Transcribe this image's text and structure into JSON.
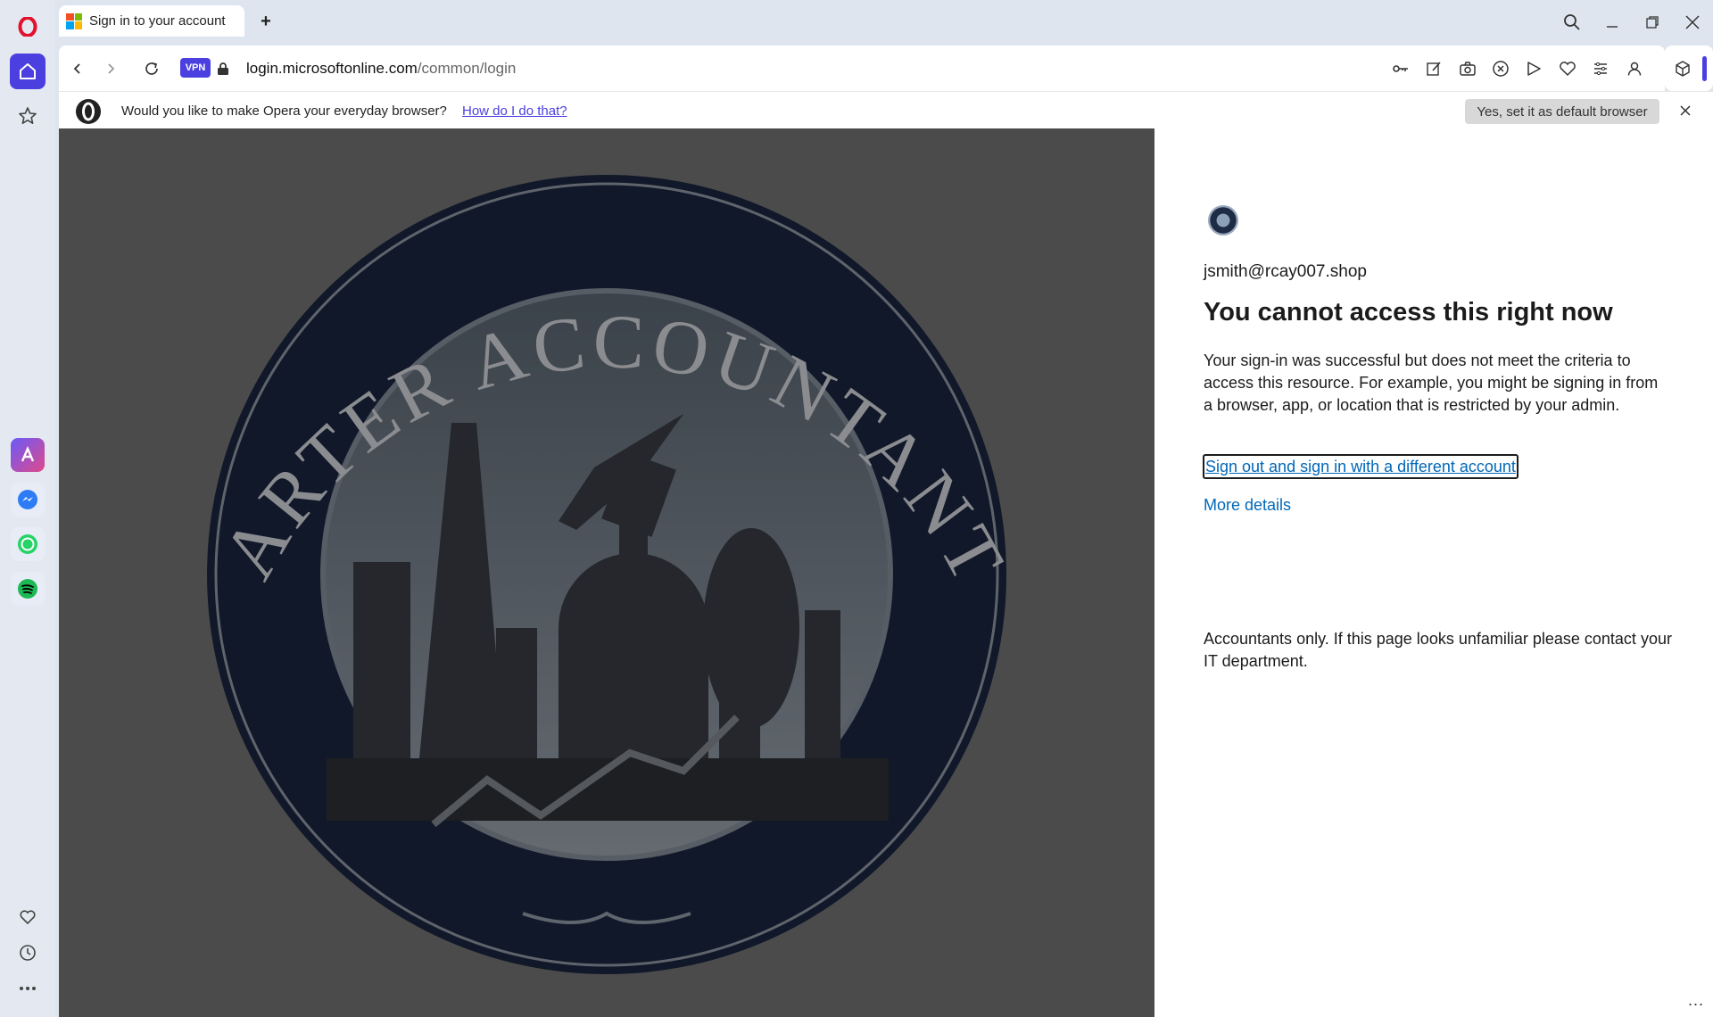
{
  "browser": {
    "tab_title": "Sign in to your account",
    "new_tab": "+",
    "vpn_label": "VPN",
    "url_domain": "login.microsoftonline.com",
    "url_path": "/common/login",
    "icons": [
      "opera-logo",
      "home-icon",
      "star-icon",
      "aria-icon",
      "messenger-icon",
      "whatsapp-icon",
      "spotify-icon",
      "heart-icon",
      "history-icon",
      "more-icon",
      "search-icon",
      "minimize-icon",
      "restore-icon",
      "close-icon",
      "back-icon",
      "forward-icon",
      "reload-icon",
      "lock-icon",
      "key-icon",
      "edit-icon",
      "camera-icon",
      "shield-icon",
      "send-icon",
      "heart-icon",
      "settings-icon",
      "account-icon",
      "box-icon"
    ]
  },
  "infobar": {
    "message": "Would you like to make Opera your everyday browser?",
    "link": "How do I do that?",
    "button": "Yes, set it as default browser",
    "close": "×"
  },
  "signin": {
    "email": "jsmith@rcay007.shop",
    "title": "You cannot access this right now",
    "description": "Your sign-in was successful but does not meet the criteria to access this resource. For example, you might be signing in from a browser, app, or location that is restricted by your admin.",
    "signout_link": "Sign out and sign in with a different account",
    "more_details": "More details",
    "notice": "Accountants only. If this page looks unfamiliar please contact your IT department.",
    "dots": "..."
  },
  "logo": {
    "text": "CARTER ACCOUNTANTS",
    "ring_color": "#1b2742",
    "inner_color": "#9aa6b5"
  }
}
